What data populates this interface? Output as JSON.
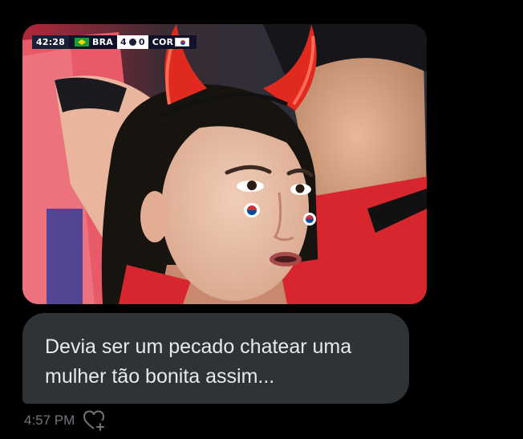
{
  "message": {
    "media": {
      "scorebug": {
        "clock": "42:28",
        "home_team": "BRA",
        "home_score": "4",
        "away_score": "0",
        "away_team": "COR"
      }
    },
    "text_line1": "Devia ser um pecado chatear uma",
    "text_line2": "mulher tão bonita assim...",
    "timestamp": "4:57 PM",
    "reaction_icon": "heart-plus-icon"
  },
  "colors": {
    "background": "#000000",
    "bubble": "#2f3336",
    "text": "#e7e9ea",
    "muted": "#71767b",
    "jersey_red": "#d8262e"
  }
}
